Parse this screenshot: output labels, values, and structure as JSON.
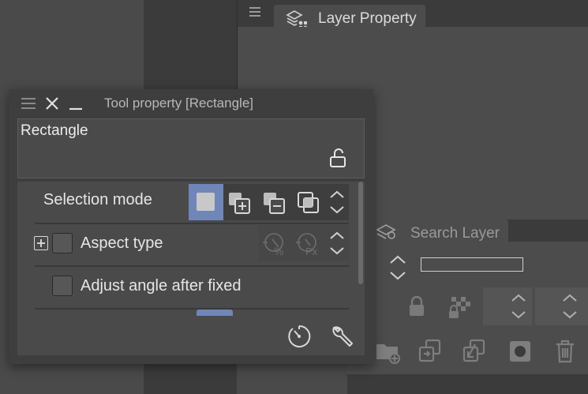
{
  "layer_property": {
    "tab_label": "Layer Property"
  },
  "search_layer": {
    "tab_label": "Search Layer"
  },
  "tool_property": {
    "title": "Tool property [Rectangle]",
    "tool_name": "Rectangle",
    "rows": {
      "selection_mode": "Selection mode",
      "aspect_type": "Aspect type",
      "adjust_angle": "Adjust angle after fixed"
    },
    "selection_mode_selected": "new-selection"
  },
  "colors": {
    "accent": "#7086b9",
    "panel": "#4a4a4a",
    "background": "#3b3b3b"
  },
  "icons": [
    "menu-icon",
    "layer-property-icon",
    "close-icon",
    "minimize-icon",
    "lock-open-icon",
    "add-selection-icon",
    "subtract-selection-icon",
    "intersect-selection-icon",
    "aspect-percent-icon",
    "aspect-px-icon",
    "clock-dial-icon",
    "wrench-icon",
    "search-layer-icon",
    "lock-icon",
    "checker-lock-icon",
    "new-folder-icon",
    "copy-layer-icon",
    "merge-down-icon",
    "mask-icon",
    "trash-icon"
  ]
}
